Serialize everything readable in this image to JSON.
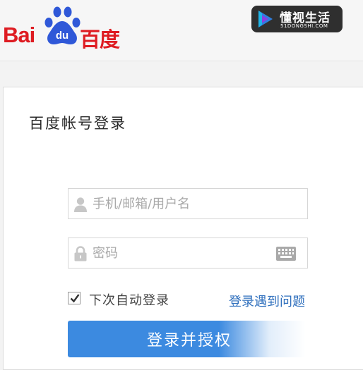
{
  "header": {
    "logo": {
      "latin_text": "Bai",
      "paw_text": "du",
      "cn_text": "百度"
    },
    "brand": {
      "name": "懂视生活",
      "domain": "51DONGSHI.COM",
      "icon": "play-triangle-icon"
    }
  },
  "login": {
    "title": "百度帐号登录",
    "username": {
      "placeholder": "手机/邮箱/用户名",
      "value": "",
      "icon": "user-icon"
    },
    "password": {
      "placeholder": "密码",
      "value": "",
      "icon": "lock-icon",
      "keyboard_icon": "keyboard-icon"
    },
    "remember": {
      "label": "下次自动登录",
      "checked": true
    },
    "help_link": "登录遇到问题",
    "submit_label": "登录并授权"
  },
  "colors": {
    "brand_red": "#de1c22",
    "paw_blue": "#2f58d8",
    "link_blue": "#2f6fbd",
    "button_blue": "#3c8ae0"
  }
}
